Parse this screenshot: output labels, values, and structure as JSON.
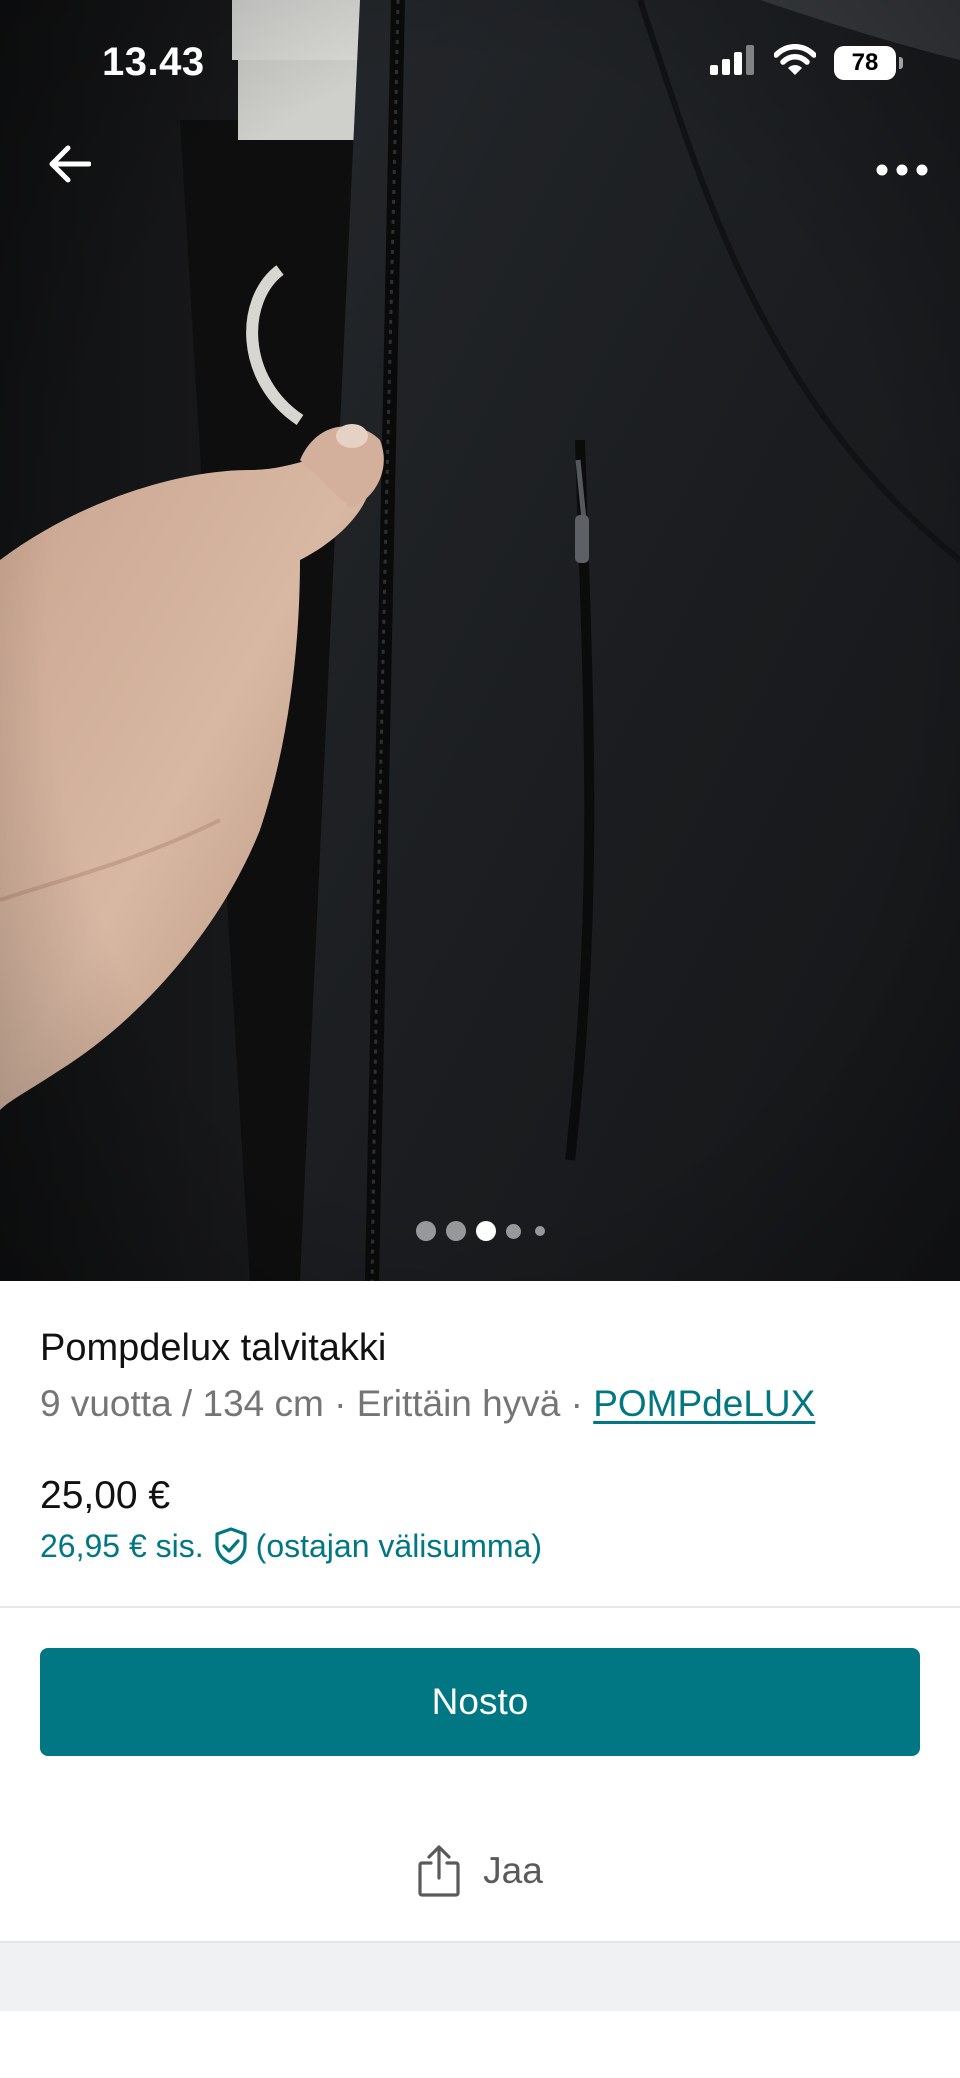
{
  "status_bar": {
    "time": "13.43",
    "battery_level": "78",
    "icons": [
      "signal-icon",
      "wifi-icon",
      "battery-icon"
    ]
  },
  "navigation": {
    "back_icon": "arrow-left-icon",
    "more_icon": "more-horizontal-icon"
  },
  "gallery": {
    "dot_count": 5,
    "active_dot_index": 2
  },
  "item": {
    "title": "Pompdelux talvitakki",
    "size": "9 vuotta / 134 cm",
    "separator": " · ",
    "condition": "Erittäin hyvä",
    "brand": "POMPdeLUX"
  },
  "pricing": {
    "price": "25,00 €",
    "buyer_price": "26,95 € sis.",
    "buyer_price_note": "(ostajan välisumma)",
    "protection_icon": "shield-check-icon"
  },
  "actions": {
    "buy_label": "Nosto",
    "share_label": "Jaa",
    "share_icon": "share-icon"
  },
  "colors": {
    "accent": "#007782",
    "text_primary": "#111111",
    "text_secondary": "#757575"
  }
}
